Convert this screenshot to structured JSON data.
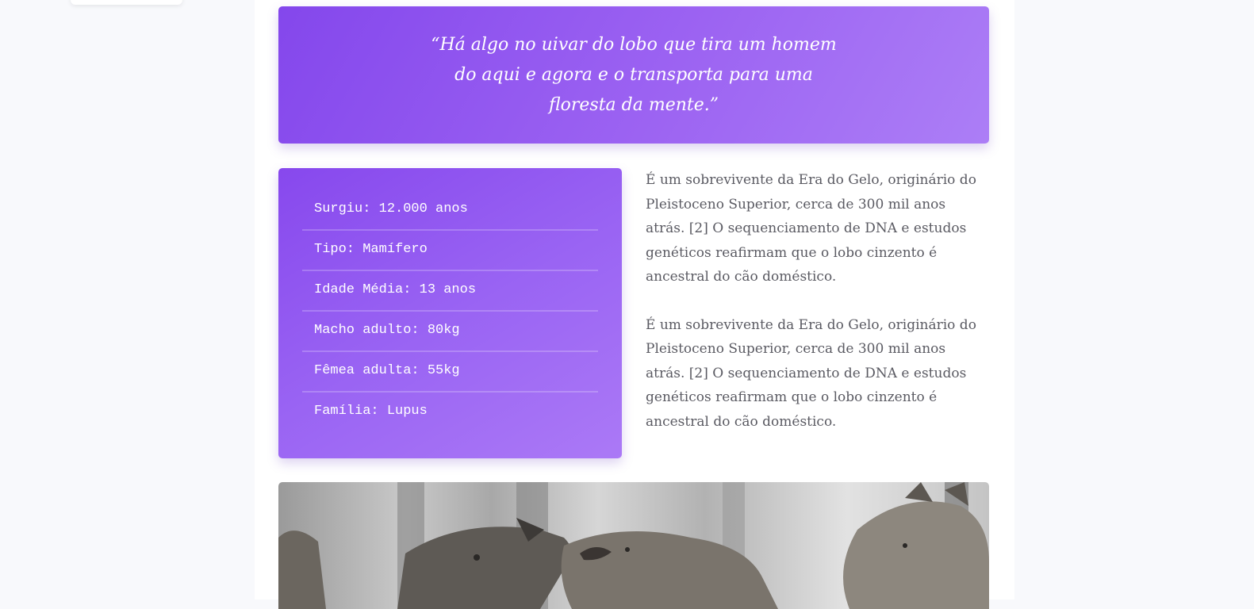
{
  "quote": {
    "text": "“Há algo no uivar do lobo que tira um homem do aqui e agora e o transporta para uma floresta da mente.”"
  },
  "facts": [
    "Surgiu: 12.000 anos",
    "Tipo: Mamífero",
    "Idade Média: 13 anos",
    "Macho adulto: 80kg",
    "Fêmea adulta: 55kg",
    "Família: Lupus"
  ],
  "paragraphs": [
    "É um sobrevivente da Era do Gelo, originário do Pleistoceno Superior, cerca de 300 mil anos atrás. [2] O sequenciamento de DNA e estudos genéticos reafirmam que o lobo cinzento é ancestral do cão doméstico.",
    "É um sobrevivente da Era do Gelo, originário do Pleistoceno Superior, cerca de 300 mil anos atrás. [2] O sequenciamento de DNA e estudos genéticos reafirmam que o lobo cinzento é ancestral do cão doméstico."
  ],
  "image": {
    "subject": "wolves-photo"
  }
}
